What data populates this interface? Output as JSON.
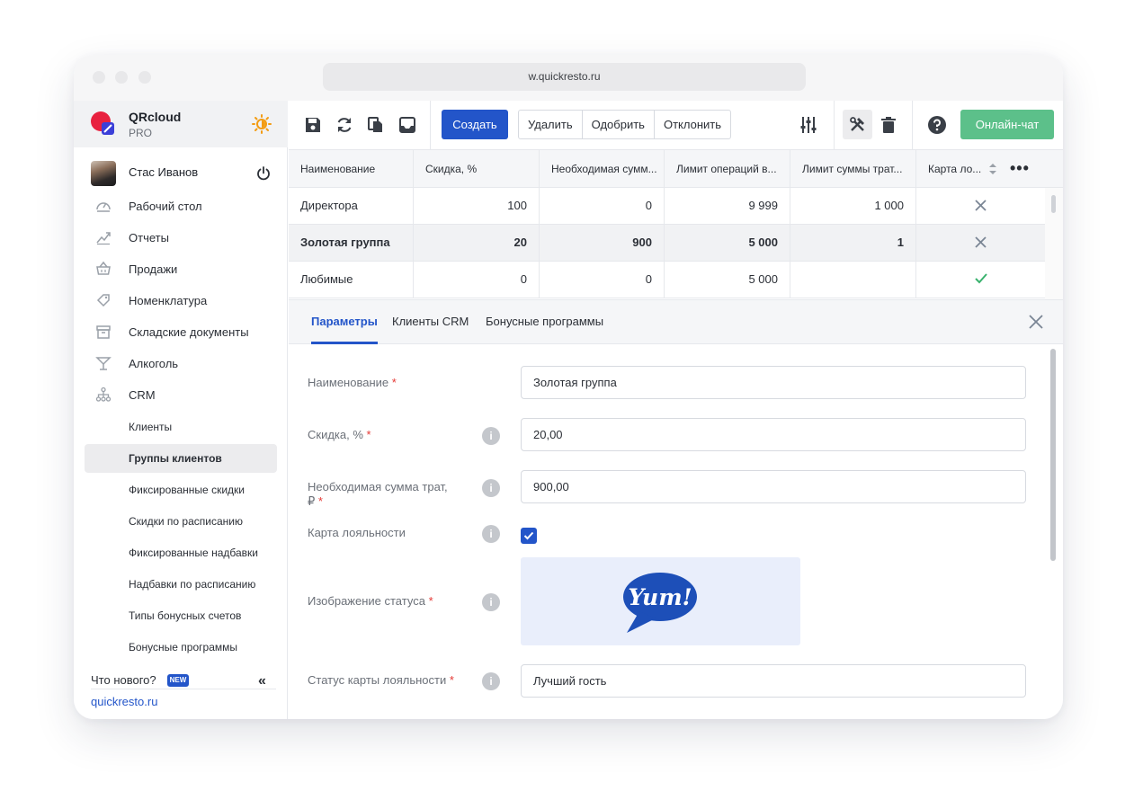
{
  "browser": {
    "url": "w.quickresto.ru"
  },
  "sidebar": {
    "brand": {
      "name": "QRcloud",
      "plan": "PRO"
    },
    "user": {
      "name": "Стас Иванов"
    },
    "nav": [
      {
        "label": "Рабочий стол",
        "icon": "dashboard-icon"
      },
      {
        "label": "Отчеты",
        "icon": "reports-icon"
      },
      {
        "label": "Продажи",
        "icon": "basket-icon"
      },
      {
        "label": "Номенклатура",
        "icon": "tag-icon"
      },
      {
        "label": "Складские документы",
        "icon": "archive-icon"
      },
      {
        "label": "Алкоголь",
        "icon": "cocktail-icon"
      },
      {
        "label": "CRM",
        "icon": "hierarchy-icon"
      }
    ],
    "crm_items": [
      {
        "label": "Клиенты"
      },
      {
        "label": "Группы клиентов",
        "active": true
      },
      {
        "label": "Фиксированные скидки"
      },
      {
        "label": "Скидки по расписанию"
      },
      {
        "label": "Фиксированные надбавки"
      },
      {
        "label": "Надбавки по расписанию"
      },
      {
        "label": "Типы бонусных счетов"
      },
      {
        "label": "Бонусные программы"
      }
    ],
    "whats_new": {
      "label": "Что нового?",
      "badge": "NEW"
    },
    "site_link": "quickresto.ru"
  },
  "toolbar": {
    "create_label": "Создать",
    "delete_label": "Удалить",
    "approve_label": "Одобрить",
    "reject_label": "Отклонить",
    "chat_label": "Онлайн-чат"
  },
  "table": {
    "columns": [
      "Наименование",
      "Скидка, %",
      "Необходимая сумм...",
      "Лимит операций в...",
      "Лимит суммы трат...",
      "Карта ло..."
    ],
    "rows": [
      {
        "name": "Директора",
        "discount": "100",
        "required_sum": "0",
        "ops_limit": "9 999",
        "spend_limit": "1 000",
        "loyalty_card": false,
        "selected": false
      },
      {
        "name": "Золотая группа",
        "discount": "20",
        "required_sum": "900",
        "ops_limit": "5 000",
        "spend_limit": "1",
        "loyalty_card": false,
        "selected": true
      },
      {
        "name": "Любимые",
        "discount": "0",
        "required_sum": "0",
        "ops_limit": "5 000",
        "spend_limit": "",
        "loyalty_card": true,
        "selected": false
      }
    ]
  },
  "panel": {
    "tabs": [
      {
        "label": "Параметры",
        "active": true
      },
      {
        "label": "Клиенты CRM"
      },
      {
        "label": "Бонусные программы"
      }
    ],
    "fields": {
      "name_label": "Наименование",
      "name_value": "Золотая группа",
      "discount_label": "Скидка, %",
      "discount_value": "20,00",
      "required_sum_label_1": "Необходимая сумма трат,",
      "required_sum_label_2": "₽",
      "required_sum_value": "900,00",
      "loyalty_card_label": "Карта лояльности",
      "loyalty_card_checked": true,
      "status_image_label": "Изображение статуса",
      "status_image_text": "Yum!",
      "card_status_label": "Статус карты лояльности",
      "card_status_value": "Лучший гость"
    },
    "required_mark": "*",
    "info_mark": "i"
  },
  "colors": {
    "accent": "#2355c9",
    "chat": "#5cc08a",
    "required": "#e53935",
    "cross": "#7a8594",
    "check": "#3ab26e"
  }
}
